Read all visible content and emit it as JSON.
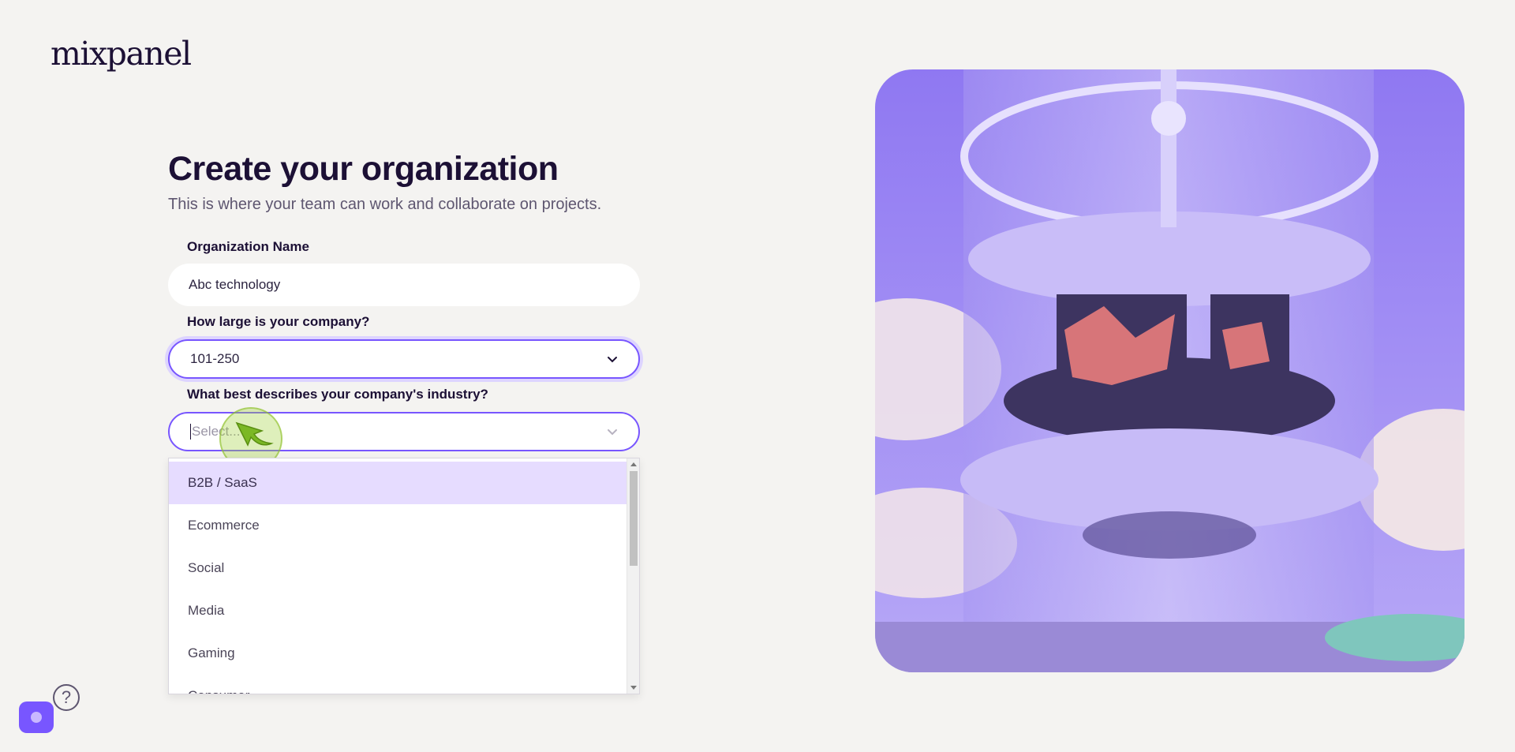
{
  "brand": {
    "logo_text": "mixpanel"
  },
  "form": {
    "title": "Create your organization",
    "subtitle": "This is where your team can work and collaborate on projects.",
    "org_name": {
      "label": "Organization Name",
      "value": "Abc technology"
    },
    "company_size": {
      "label": "How large is your company?",
      "value": "101-250"
    },
    "industry": {
      "label": "What best describes your company's industry?",
      "placeholder": "Select...",
      "options": [
        "B2B / SaaS",
        "Ecommerce",
        "Social",
        "Media",
        "Gaming",
        "Consumer"
      ],
      "highlighted_index": 0
    }
  },
  "footer": {
    "help_symbol": "?"
  },
  "colors": {
    "accent": "#7856ff",
    "highlight": "#e6dcff",
    "background": "#f4f3f1"
  },
  "icons": [
    "chevron-down-icon",
    "help-icon",
    "chat-icon",
    "pointer-arrow-icon"
  ]
}
